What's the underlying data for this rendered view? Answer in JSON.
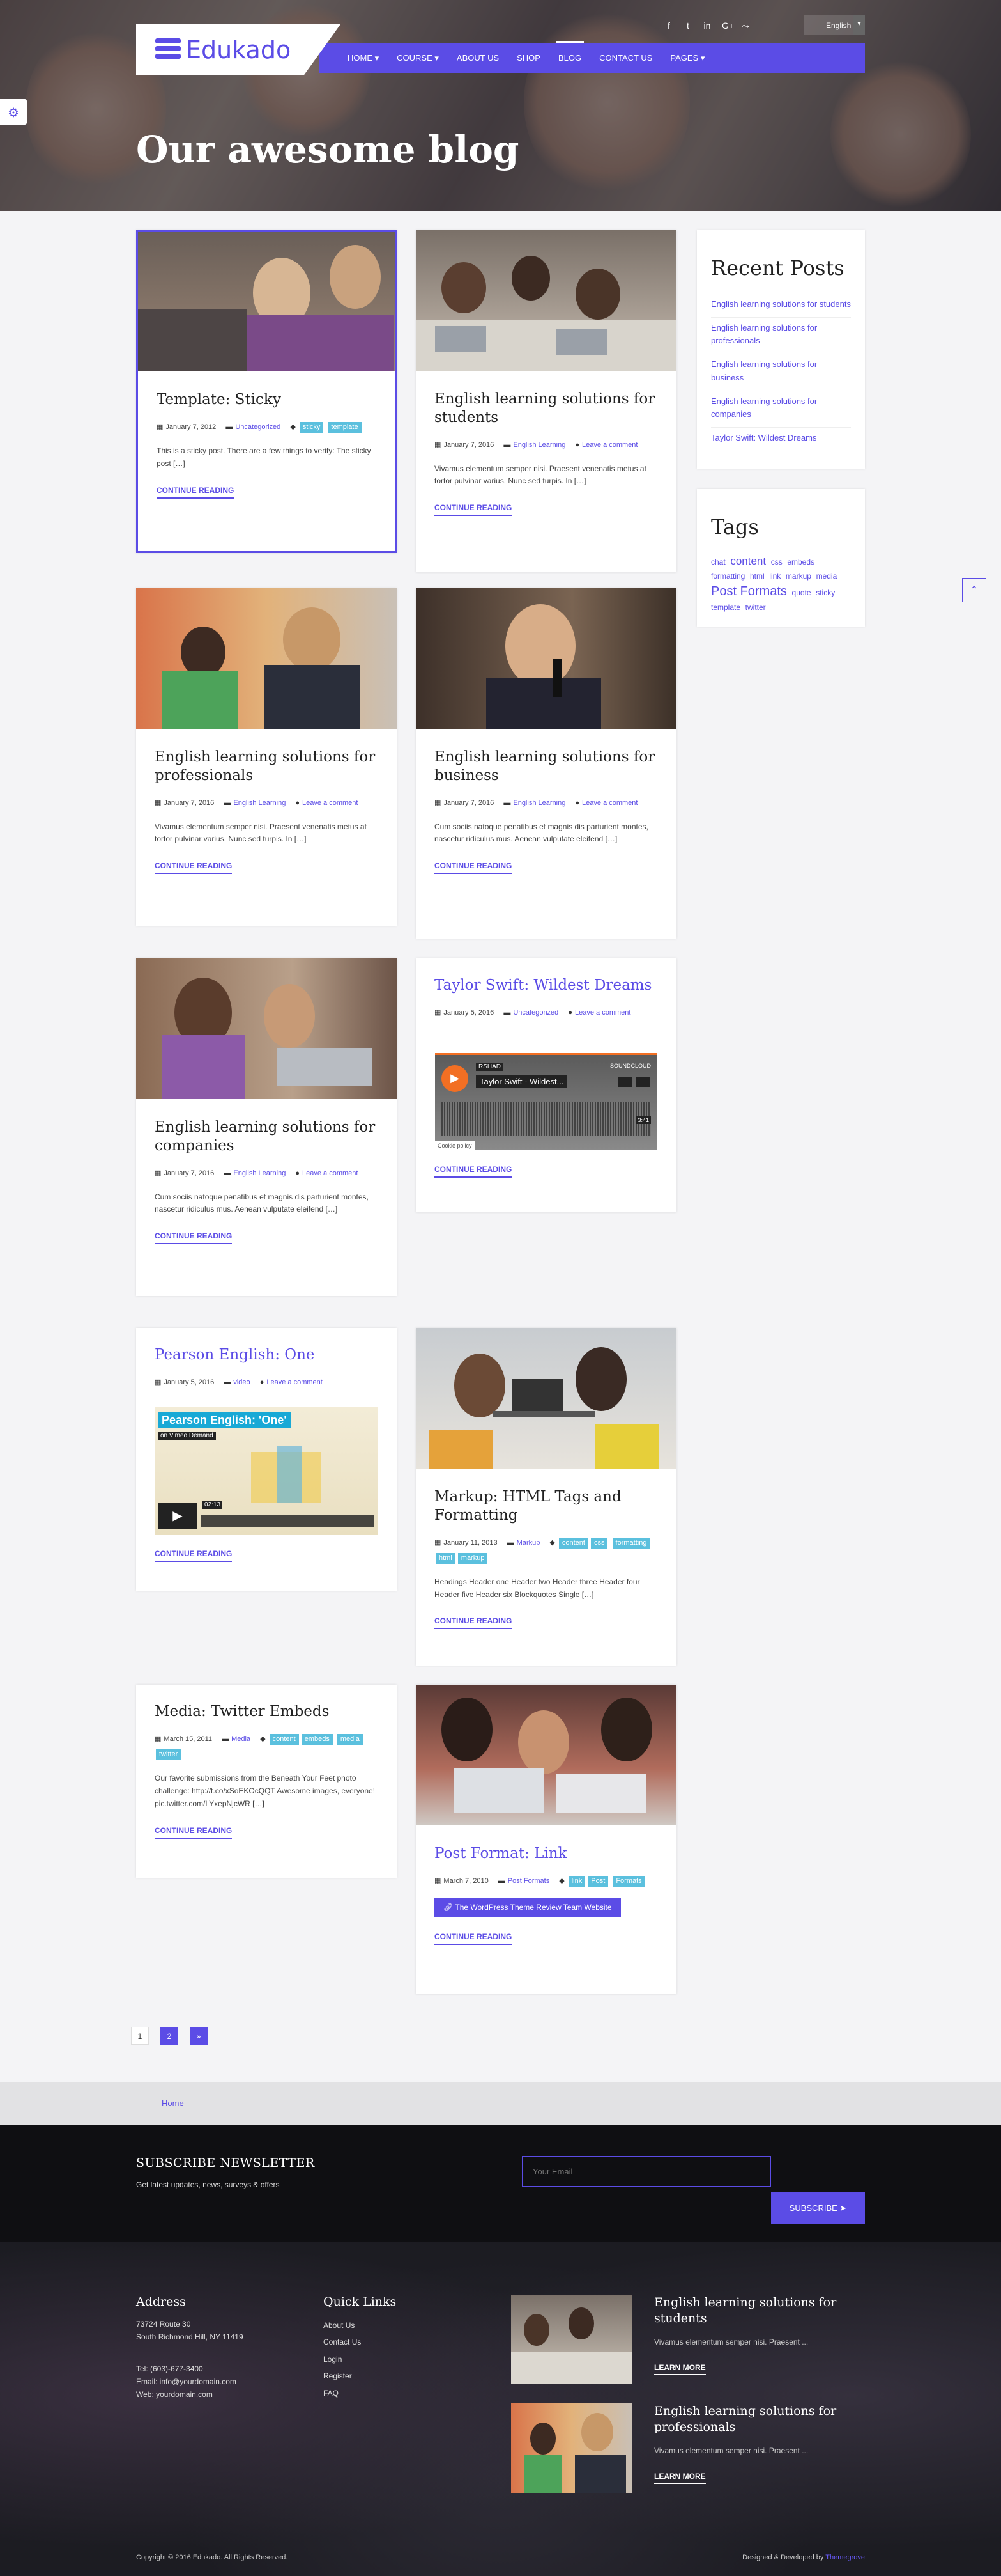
{
  "header": {
    "logo_text": "Edukado",
    "language": "English",
    "social_icons": [
      "facebook-icon",
      "twitter-icon",
      "linkedin-icon",
      "google-plus-icon",
      "share-icon"
    ],
    "nav": [
      {
        "label": "HOME ▾",
        "active": false
      },
      {
        "label": "COURSE ▾",
        "active": false
      },
      {
        "label": "ABOUT US",
        "active": false
      },
      {
        "label": "SHOP",
        "active": false
      },
      {
        "label": "BLOG",
        "active": true
      },
      {
        "label": "CONTACT US",
        "active": false
      },
      {
        "label": "PAGES ▾",
        "active": false
      }
    ],
    "hero_title": "Our awesome blog"
  },
  "posts": [
    {
      "title": "Template: Sticky",
      "date": "January 7, 2012",
      "category": "Uncategorized",
      "tags": [
        "sticky",
        "template"
      ],
      "excerpt": "This is a sticky post. There are a few things to verify: The sticky post […]",
      "read_more": "CONTINUE READING"
    },
    {
      "title": "English learning solutions for students",
      "date": "January 7, 2016",
      "category": "English Learning",
      "comment": "Leave a comment",
      "excerpt": "Vivamus elementum semper nisi. Praesent venenatis metus at tortor pulvinar varius. Nunc sed turpis. In […]",
      "read_more": "CONTINUE READING"
    },
    {
      "title": "English learning solutions for professionals",
      "date": "January 7, 2016",
      "category": "English Learning",
      "comment": "Leave a comment",
      "excerpt": "Vivamus elementum semper nisi. Praesent venenatis metus at tortor pulvinar varius. Nunc sed turpis. In […]",
      "read_more": "CONTINUE READING"
    },
    {
      "title": "English learning solutions for business",
      "date": "January 7, 2016",
      "category": "English Learning",
      "comment": "Leave a comment",
      "excerpt": "Cum sociis natoque penatibus et magnis dis parturient montes, nascetur ridiculus mus. Aenean vulputate eleifend […]",
      "read_more": "CONTINUE READING"
    },
    {
      "title": "English learning solutions for companies",
      "date": "January 7, 2016",
      "category": "English Learning",
      "comment": "Leave a comment",
      "excerpt": "Cum sociis natoque penatibus et magnis dis parturient montes, nascetur ridiculus mus. Aenean vulputate eleifend […]",
      "read_more": "CONTINUE READING"
    },
    {
      "title": "Taylor Swift: Wildest Dreams",
      "date": "January 5, 2016",
      "category": "Uncategorized",
      "comment": "Leave a comment",
      "embed_title": "Taylor Swift - Wildest...",
      "embed_user": "RSHAD",
      "embed_brand": "SOUNDCLOUD",
      "embed_cookie": "Cookie policy",
      "embed_time": "3:41",
      "read_more": "CONTINUE READING"
    },
    {
      "title": "Pearson English: One",
      "date": "January 5, 2016",
      "category": "video",
      "comment": "Leave a comment",
      "video_title": "Pearson English: 'One'",
      "video_sub": "on Vimeo Demand",
      "video_time": "02:13",
      "read_more": "CONTINUE READING"
    },
    {
      "title": "Markup: HTML Tags and Formatting",
      "date": "January 11, 2013",
      "category": "Markup",
      "tags": [
        "content",
        "css",
        "formatting",
        "html",
        "markup"
      ],
      "excerpt": "Headings Header one Header two Header three Header four Header five Header six Blockquotes Single […]",
      "read_more": "CONTINUE READING"
    },
    {
      "title": "Media: Twitter Embeds",
      "date": "March 15, 2011",
      "category": "Media",
      "tags": [
        "content",
        "embeds",
        "media",
        "twitter"
      ],
      "excerpt": "Our favorite submissions from the Beneath Your Feet photo challenge: http://t.co/xSoEKOcQQT Awesome images, everyone! pic.twitter.com/LYxepNjcWR […]",
      "read_more": "CONTINUE READING"
    },
    {
      "title": "Post Format: Link",
      "date": "March 7, 2010",
      "category": "Post Formats",
      "tags": [
        "link",
        "Post",
        "Formats"
      ],
      "link_button": "The WordPress Theme Review Team Website",
      "read_more": "CONTINUE READING"
    }
  ],
  "sidebar": {
    "recent_title": "Recent Posts",
    "recent": [
      "English learning solutions for students",
      "English learning solutions for professionals",
      "English learning solutions for business",
      "English learning solutions for companies",
      "Taylor Swift: Wildest Dreams"
    ],
    "tags_title": "Tags",
    "tags": [
      {
        "label": "chat",
        "size": 12
      },
      {
        "label": "content",
        "size": 17
      },
      {
        "label": "css",
        "size": 12
      },
      {
        "label": "embeds",
        "size": 12
      },
      {
        "label": "formatting",
        "size": 12
      },
      {
        "label": "html",
        "size": 12
      },
      {
        "label": "link",
        "size": 12
      },
      {
        "label": "markup",
        "size": 12
      },
      {
        "label": "media",
        "size": 12
      },
      {
        "label": "Post Formats",
        "size": 20
      },
      {
        "label": "quote",
        "size": 12
      },
      {
        "label": "sticky",
        "size": 12
      },
      {
        "label": "template",
        "size": 12
      },
      {
        "label": "twitter",
        "size": 12
      }
    ]
  },
  "pagination": [
    "1",
    "2",
    "»"
  ],
  "breadcrumb": "Home",
  "footer": {
    "newsletter_title": "SUBSCRIBE NEWSLETTER",
    "newsletter_sub": "Get latest updates, news, surveys & offers",
    "email_placeholder": "Your Email",
    "subscribe_label": "SUBSCRIBE",
    "address_title": "Address",
    "address_lines": [
      "73724 Route 30",
      "South Richmond Hill, NY 11419"
    ],
    "contact_lines": [
      "Tel: (603)-677-3400",
      "Email: info@yourdomain.com",
      "Web: yourdomain.com"
    ],
    "quicklinks_title": "Quick Links",
    "quicklinks": [
      "About Us",
      "Contact Us",
      "Login",
      "Register",
      "FAQ"
    ],
    "posts": [
      {
        "title": "English learning solutions for students",
        "excerpt": "Vivamus elementum semper nisi. Praesent ...",
        "more": "LEARN MORE"
      },
      {
        "title": "English learning solutions for professionals",
        "excerpt": "Vivamus elementum semper nisi. Praesent ...",
        "more": "LEARN MORE"
      }
    ],
    "copyright": "Copyright © 2016 Edukado. All Rights Reserved.",
    "designed_prefix": "Designed & Developed by ",
    "designed_brand": "Themegrove"
  },
  "colors": {
    "accent": "#5b4ce6",
    "tag": "#5bc0de",
    "footer_bg": "#1c1c22"
  }
}
